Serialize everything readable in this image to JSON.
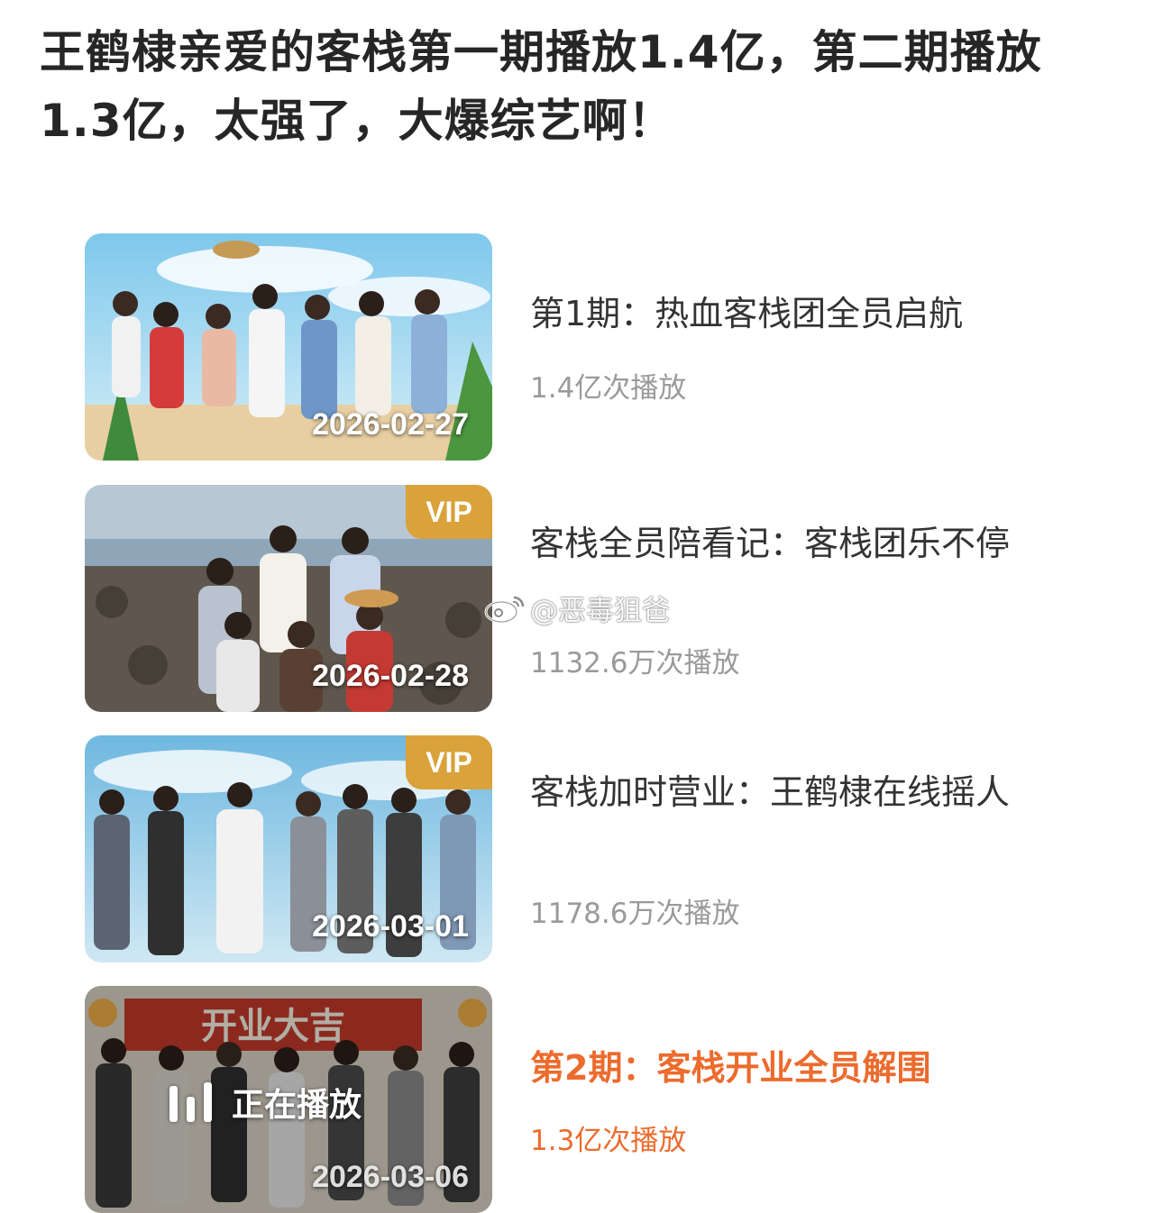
{
  "post": {
    "title": "王鹤棣亲爱的客栈第一期播放1.4亿，第二期播放1.3亿，太强了，大爆综艺啊！"
  },
  "episodes": [
    {
      "date": "2026-02-27",
      "vip": "",
      "title": "第1期：热血客栈团全员启航",
      "plays": "1.4亿次播放",
      "playing": ""
    },
    {
      "date": "2026-02-28",
      "vip": "VIP",
      "title": "客栈全员陪看记：客栈团乐不停",
      "plays": "1132.6万次播放",
      "playing": ""
    },
    {
      "date": "2026-03-01",
      "vip": "VIP",
      "title": "客栈加时营业：王鹤棣在线摇人",
      "plays": "1178.6万次播放",
      "playing": ""
    },
    {
      "date": "2026-03-06",
      "vip": "",
      "title": "第2期：客栈开业全员解围",
      "plays": "1.3亿次播放",
      "playing": "正在播放",
      "banner": "开业大吉"
    }
  ],
  "watermark": {
    "text": "@恶毒狙爸",
    "icon": "weibo-logo-icon"
  },
  "colors": {
    "active": "#ec6b2d",
    "vip_badge": "#d9a23a",
    "meta_text": "#9a9a9a"
  }
}
